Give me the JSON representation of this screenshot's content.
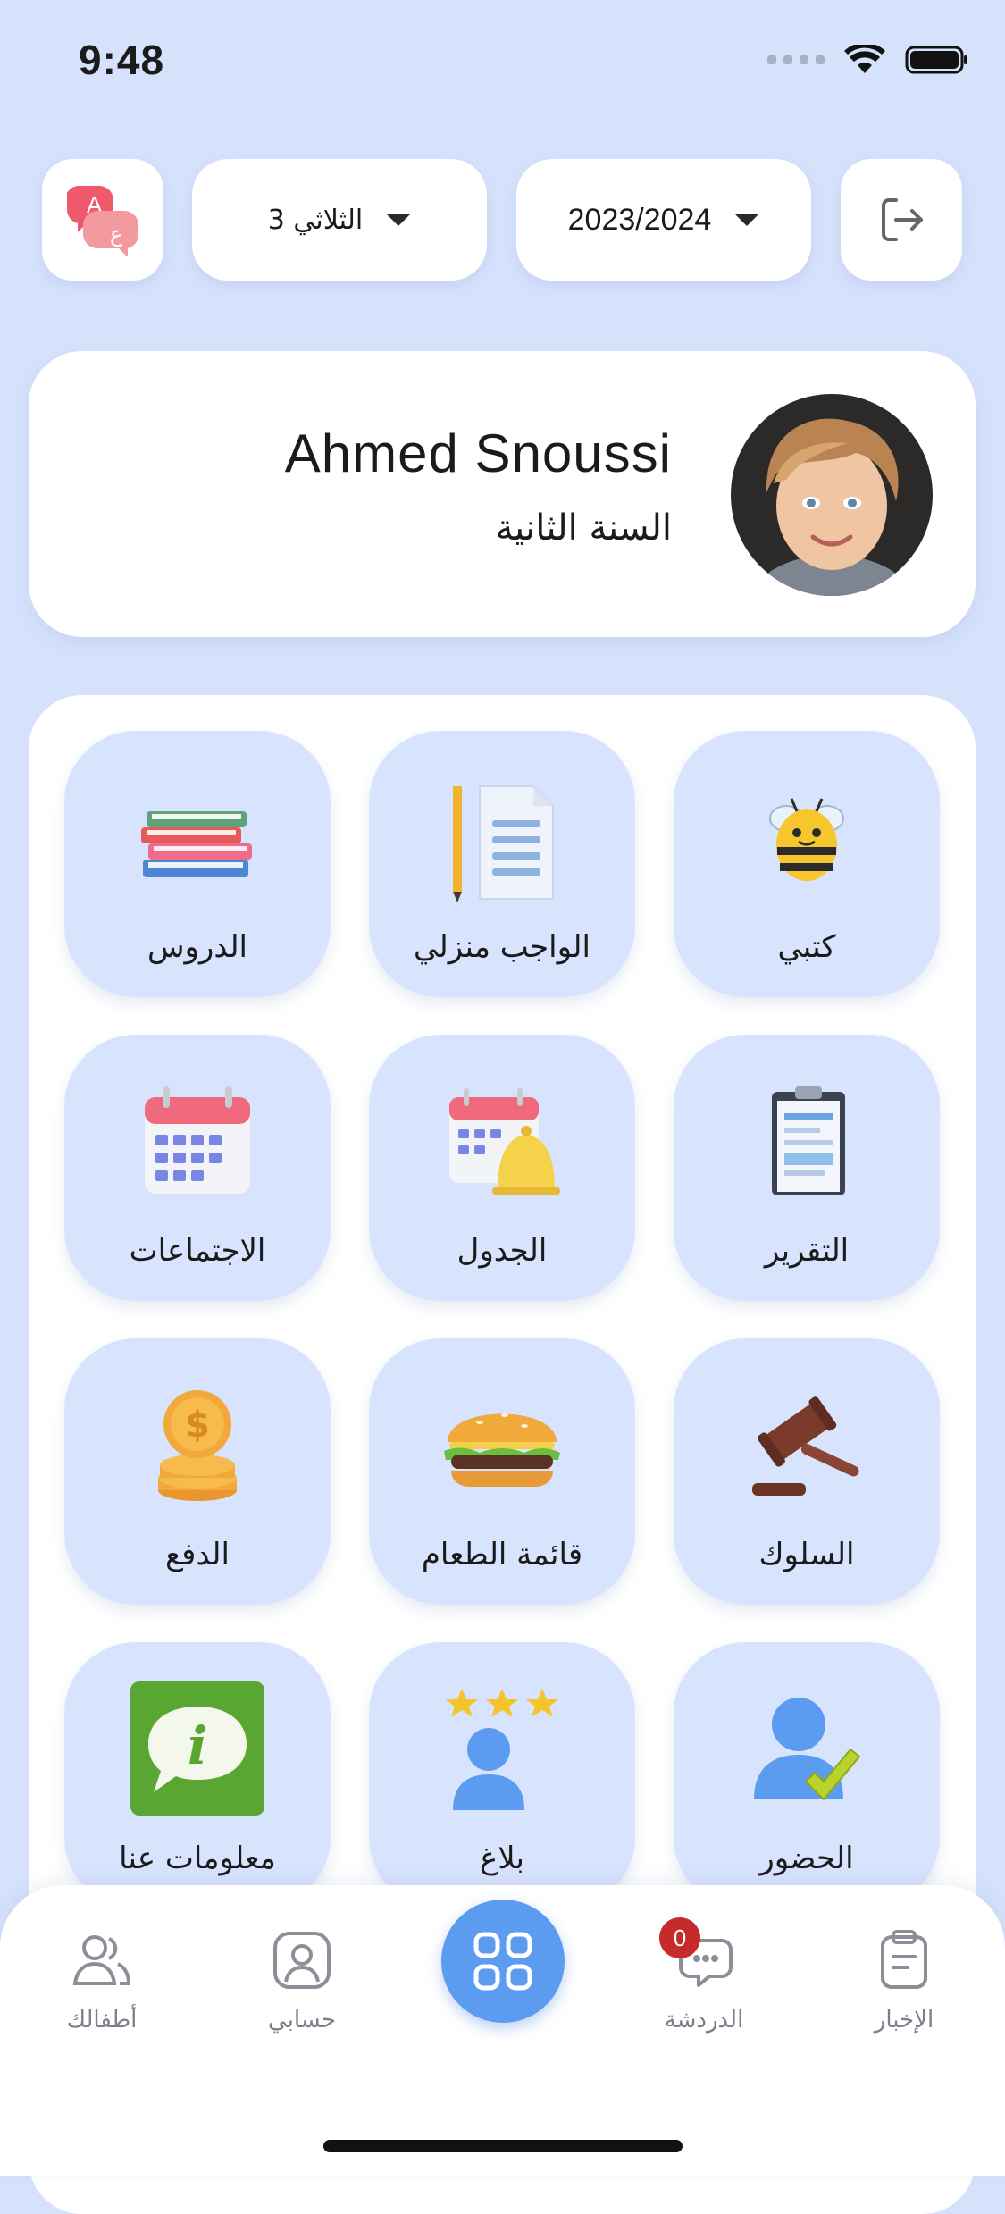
{
  "status_bar": {
    "time": "9:48"
  },
  "header": {
    "term_selected": "الثلاثي 3",
    "year_selected": "2023/2024",
    "language_icon": "language-icon",
    "logout_icon": "logout-icon"
  },
  "profile": {
    "name": "Ahmed Snoussi",
    "grade": "السنة الثانية"
  },
  "menu": {
    "items": [
      {
        "label": "كتبي",
        "icon": "bee-icon"
      },
      {
        "label": "الواجب منزلي",
        "icon": "homework-icon"
      },
      {
        "label": "الدروس",
        "icon": "books-icon"
      },
      {
        "label": "التقرير",
        "icon": "report-icon"
      },
      {
        "label": "الجدول",
        "icon": "schedule-icon"
      },
      {
        "label": "الاجتماعات",
        "icon": "calendar-icon"
      },
      {
        "label": "السلوك",
        "icon": "gavel-icon"
      },
      {
        "label": "قائمة الطعام",
        "icon": "burger-icon"
      },
      {
        "label": "الدفع",
        "icon": "coins-icon"
      },
      {
        "label": "الحضور",
        "icon": "attendance-icon"
      },
      {
        "label": "بلاغ",
        "icon": "rating-icon"
      },
      {
        "label": "معلومات عنا",
        "icon": "info-icon"
      }
    ]
  },
  "bottom_nav": {
    "news": "الإخبار",
    "chat": "الدردشة",
    "chat_badge": "0",
    "account": "حسابي",
    "children": "أطفالك"
  },
  "colors": {
    "background": "#d6e2fc",
    "tile": "#d8e3fd",
    "accent": "#5b9cf0",
    "badge": "#c62a2a"
  }
}
